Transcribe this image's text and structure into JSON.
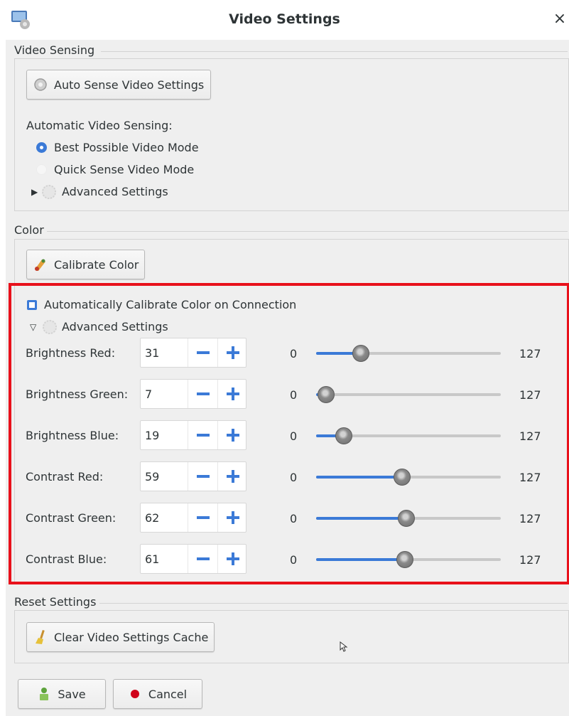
{
  "window": {
    "title": "Video Settings",
    "close_glyph": "×"
  },
  "video_sensing": {
    "group_label": "Video Sensing",
    "auto_sense_button": "Auto Sense Video Settings",
    "automatic_label": "Automatic Video Sensing:",
    "options": [
      {
        "label": "Best Possible Video Mode",
        "selected": true
      },
      {
        "label": "Quick Sense Video Mode",
        "selected": false
      }
    ],
    "advanced_label": "Advanced Settings",
    "advanced_expanded": false
  },
  "color": {
    "group_label": "Color",
    "calibrate_button": "Calibrate Color",
    "auto_calibrate_label": "Automatically Calibrate Color on Connection",
    "auto_calibrate_checked": true,
    "advanced_label": "Advanced Settings",
    "advanced_expanded": true,
    "min_label": "0",
    "max_label": "127",
    "range": [
      0,
      127
    ],
    "rows": [
      {
        "label": "Brightness Red:",
        "value": 31
      },
      {
        "label": "Brightness Green:",
        "value": 7
      },
      {
        "label": "Brightness Blue:",
        "value": 19
      },
      {
        "label": "Contrast Red:",
        "value": 59
      },
      {
        "label": "Contrast Green:",
        "value": 62
      },
      {
        "label": "Contrast Blue:",
        "value": 61
      }
    ]
  },
  "reset": {
    "group_label": "Reset Settings",
    "clear_button": "Clear Video Settings Cache"
  },
  "footer": {
    "save_button": "Save",
    "cancel_button": "Cancel"
  },
  "colors": {
    "accent": "#3b7ad7",
    "highlight_border": "#e8111b",
    "cancel_dot": "#d0021b"
  }
}
